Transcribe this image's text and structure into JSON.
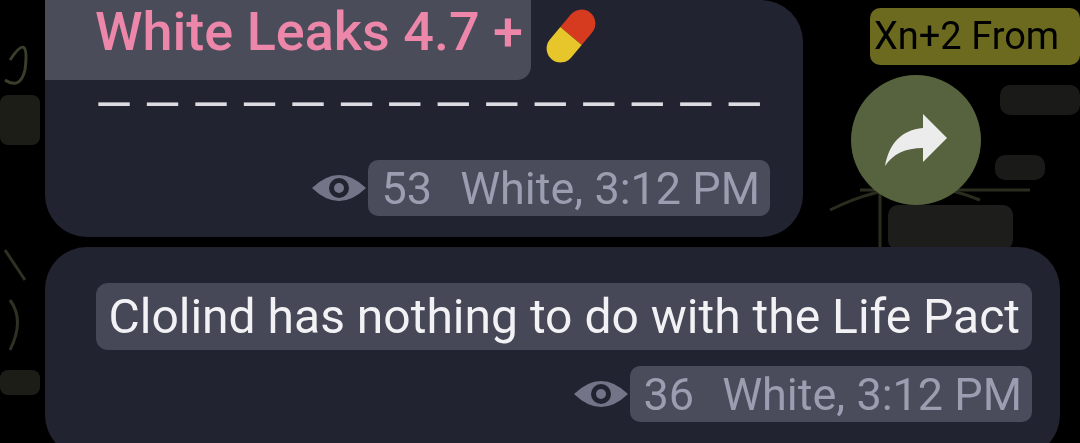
{
  "top_label": {
    "text": "Xn+2 From"
  },
  "messages": [
    {
      "kind": "titled",
      "title": "White Leaks 4.7 +",
      "body": "——————————————",
      "views": "53",
      "signature": "White, 3:12 PM"
    },
    {
      "kind": "plain",
      "body": "Clolind has nothing to do with the Life Pact",
      "views": "36",
      "signature": "White, 3:12 PM"
    }
  ]
}
